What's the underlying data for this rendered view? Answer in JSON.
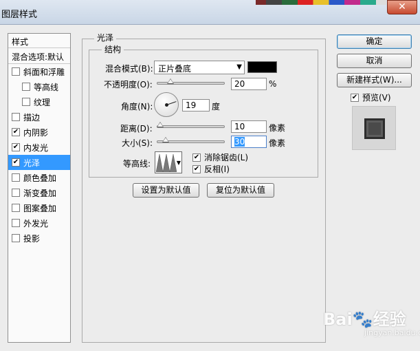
{
  "window": {
    "title": "图层样式",
    "close_glyph": "✕"
  },
  "left_panel": {
    "header": "样式",
    "blend_options": "混合选项:默认",
    "items": [
      {
        "label": "斜面和浮雕",
        "checked": false,
        "sub": false,
        "selected": false
      },
      {
        "label": "等高线",
        "checked": false,
        "sub": true,
        "selected": false
      },
      {
        "label": "纹理",
        "checked": false,
        "sub": true,
        "selected": false
      },
      {
        "label": "描边",
        "checked": false,
        "sub": false,
        "selected": false
      },
      {
        "label": "内阴影",
        "checked": true,
        "sub": false,
        "selected": false
      },
      {
        "label": "内发光",
        "checked": true,
        "sub": false,
        "selected": false
      },
      {
        "label": "光泽",
        "checked": true,
        "sub": false,
        "selected": true
      },
      {
        "label": "颜色叠加",
        "checked": false,
        "sub": false,
        "selected": false
      },
      {
        "label": "渐变叠加",
        "checked": false,
        "sub": false,
        "selected": false
      },
      {
        "label": "图案叠加",
        "checked": false,
        "sub": false,
        "selected": false
      },
      {
        "label": "外发光",
        "checked": false,
        "sub": false,
        "selected": false
      },
      {
        "label": "投影",
        "checked": false,
        "sub": false,
        "selected": false
      }
    ]
  },
  "satin": {
    "group_title": "光泽",
    "structure_title": "结构",
    "blend_mode_label": "混合模式(B):",
    "blend_mode_value": "正片叠底",
    "blend_color": "#000000",
    "opacity_label": "不透明度(O):",
    "opacity_value": "20",
    "opacity_unit": "%",
    "opacity_level": 0.2,
    "angle_label": "角度(N):",
    "angle_value": "19",
    "angle_unit": "度",
    "distance_label": "距离(D):",
    "distance_value": "10",
    "distance_unit": "像素",
    "distance_level": 0.04,
    "size_label": "大小(S):",
    "size_value": "30",
    "size_unit": "像素",
    "size_level": 0.12,
    "contour_label": "等高线:",
    "antialias_label": "消除锯齿(L)",
    "antialias_checked": true,
    "invert_label": "反相(I)",
    "invert_checked": true,
    "make_default": "设置为默认值",
    "reset_default": "复位为默认值"
  },
  "actions": {
    "ok": "确定",
    "cancel": "取消",
    "new_style": "新建样式(W)...",
    "preview_label": "预览(V)",
    "preview_checked": true
  },
  "watermark": {
    "brand": "Bai",
    "suffix": "经验",
    "url": "jingyan.baidu.com"
  }
}
